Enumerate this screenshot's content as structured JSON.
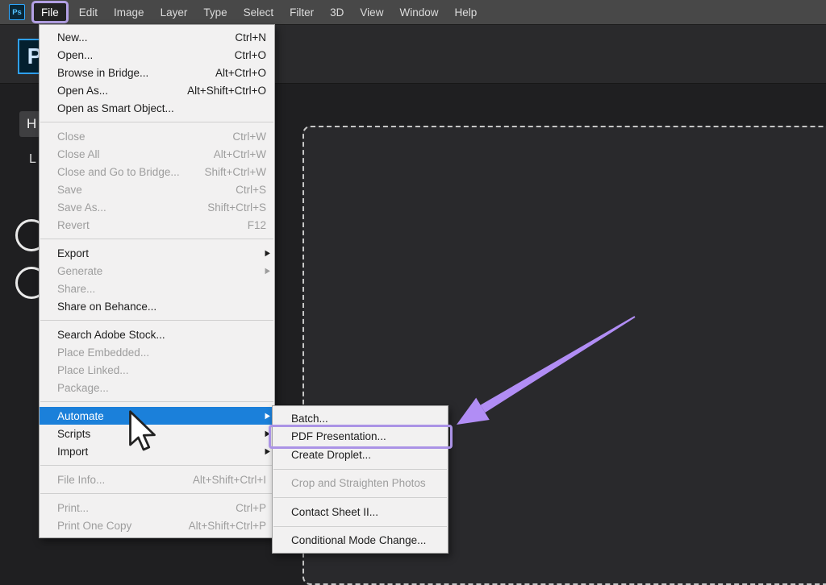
{
  "menubar": {
    "app_icon_label": "Ps",
    "items": [
      {
        "label": "File",
        "active": true
      },
      {
        "label": "Edit"
      },
      {
        "label": "Image"
      },
      {
        "label": "Layer"
      },
      {
        "label": "Type"
      },
      {
        "label": "Select"
      },
      {
        "label": "Filter"
      },
      {
        "label": "3D"
      },
      {
        "label": "View"
      },
      {
        "label": "Window"
      },
      {
        "label": "Help"
      }
    ]
  },
  "home": {
    "logo_letter": "P",
    "home_initial": "H",
    "learn_initial": "L"
  },
  "file_menu": {
    "groups": [
      {
        "items": [
          {
            "label": "New...",
            "shortcut": "Ctrl+N"
          },
          {
            "label": "Open...",
            "shortcut": "Ctrl+O"
          },
          {
            "label": "Browse in Bridge...",
            "shortcut": "Alt+Ctrl+O"
          },
          {
            "label": "Open As...",
            "shortcut": "Alt+Shift+Ctrl+O"
          },
          {
            "label": "Open as Smart Object..."
          }
        ]
      },
      {
        "items": [
          {
            "label": "Close",
            "shortcut": "Ctrl+W",
            "disabled": true
          },
          {
            "label": "Close All",
            "shortcut": "Alt+Ctrl+W",
            "disabled": true
          },
          {
            "label": "Close and Go to Bridge...",
            "shortcut": "Shift+Ctrl+W",
            "disabled": true
          },
          {
            "label": "Save",
            "shortcut": "Ctrl+S",
            "disabled": true
          },
          {
            "label": "Save As...",
            "shortcut": "Shift+Ctrl+S",
            "disabled": true
          },
          {
            "label": "Revert",
            "shortcut": "F12",
            "disabled": true
          }
        ]
      },
      {
        "items": [
          {
            "label": "Export",
            "submenu": true
          },
          {
            "label": "Generate",
            "submenu": true,
            "disabled": true
          },
          {
            "label": "Share...",
            "disabled": true
          },
          {
            "label": "Share on Behance..."
          }
        ]
      },
      {
        "items": [
          {
            "label": "Search Adobe Stock..."
          },
          {
            "label": "Place Embedded...",
            "disabled": true
          },
          {
            "label": "Place Linked...",
            "disabled": true
          },
          {
            "label": "Package...",
            "disabled": true
          }
        ]
      },
      {
        "items": [
          {
            "label": "Automate",
            "submenu": true,
            "highlighted": true
          },
          {
            "label": "Scripts",
            "submenu": true
          },
          {
            "label": "Import",
            "submenu": true
          }
        ]
      },
      {
        "items": [
          {
            "label": "File Info...",
            "shortcut": "Alt+Shift+Ctrl+I",
            "disabled": true
          }
        ]
      },
      {
        "items": [
          {
            "label": "Print...",
            "shortcut": "Ctrl+P",
            "disabled": true
          },
          {
            "label": "Print One Copy",
            "shortcut": "Alt+Shift+Ctrl+P",
            "disabled": true
          }
        ]
      }
    ]
  },
  "automate_submenu": {
    "groups": [
      {
        "items": [
          {
            "label": "Batch..."
          },
          {
            "label": "PDF Presentation...",
            "boxed": true
          },
          {
            "label": "Create Droplet..."
          }
        ]
      },
      {
        "items": [
          {
            "label": "Crop and Straighten Photos",
            "disabled": true
          }
        ]
      },
      {
        "items": [
          {
            "label": "Contact Sheet II..."
          }
        ]
      },
      {
        "items": [
          {
            "label": "Conditional Mode Change..."
          }
        ]
      }
    ]
  },
  "annotation_colors": {
    "highlight_purple": "#b3a0e4",
    "boxed_purple": "#ab93e6",
    "arrow_purple": "#b18df5",
    "menu_highlight_blue": "#1b80da"
  }
}
